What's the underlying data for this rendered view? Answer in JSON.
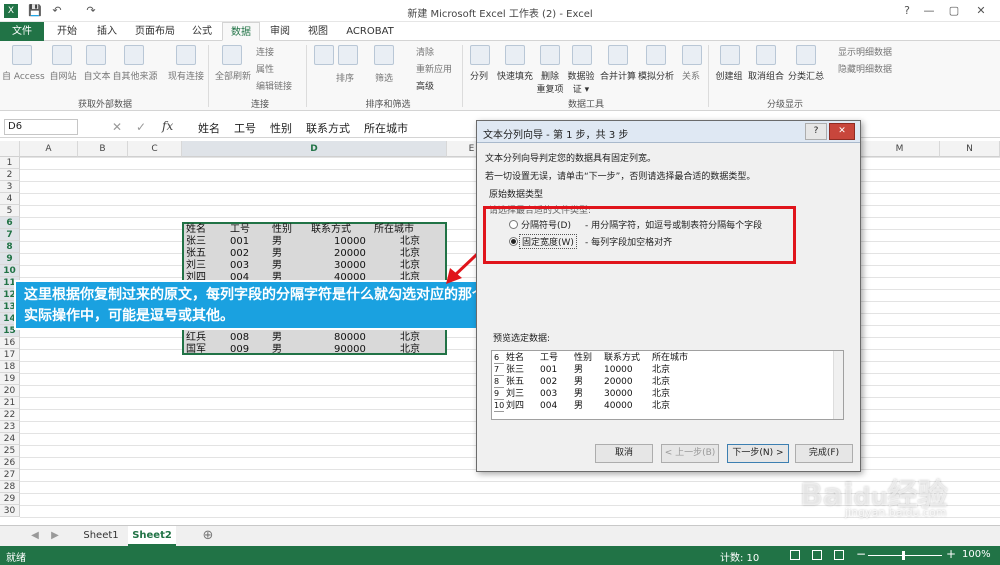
{
  "window": {
    "title": "新建 Microsoft Excel 工作表 (2) - Excel",
    "help": "?",
    "minimize": "—",
    "restore": "▢",
    "close": "✕"
  },
  "quick_access": {
    "save": "💾",
    "undo": "↶",
    "redo": "↷"
  },
  "tabs": [
    "文件",
    "开始",
    "插入",
    "页面布局",
    "公式",
    "数据",
    "审阅",
    "视图",
    "ACROBAT"
  ],
  "ribbon": {
    "get_external": {
      "items": [
        "自 Access",
        "自网站",
        "自文本",
        "自其他来源",
        "现有连接"
      ],
      "label": "获取外部数据"
    },
    "connections": {
      "refresh": "全部刷新",
      "items": [
        "连接",
        "属性",
        "编辑链接"
      ],
      "label": "连接"
    },
    "sort_filter": {
      "sort": "排序",
      "filter": "筛选",
      "items": [
        "清除",
        "重新应用",
        "高级"
      ],
      "label": "排序和筛选"
    },
    "data_tools": {
      "items": [
        "分列",
        "快速填充",
        "删除\n重复项",
        "数据验\n证 ▾",
        "合并计算",
        "模拟分析",
        "关系"
      ],
      "label": "数据工具"
    },
    "outline": {
      "items": [
        "创建组",
        "取消组合",
        "分类汇总"
      ],
      "right": [
        "显示明细数据",
        "隐藏明细数据"
      ],
      "label": "分级显示"
    }
  },
  "formula_bar": {
    "name_box": "D6",
    "fx": "fx",
    "content": "姓名    工号    性别    联系方式    所在城市"
  },
  "columns": [
    "A",
    "B",
    "C",
    "D",
    "E",
    "M",
    "N"
  ],
  "rows": [
    "1",
    "2",
    "3",
    "4",
    "5",
    "6",
    "7",
    "8",
    "9",
    "10",
    "11",
    "12",
    "13",
    "14",
    "15",
    "16",
    "17",
    "18",
    "19",
    "20",
    "21",
    "22",
    "23",
    "24",
    "25",
    "26",
    "27",
    "28",
    "29",
    "30"
  ],
  "table": {
    "header": [
      "姓名",
      "工号",
      "性别",
      "联系方式",
      "所在城市"
    ],
    "rows": [
      [
        "张三",
        "001",
        "男",
        "10000",
        "北京"
      ],
      [
        "张五",
        "002",
        "男",
        "20000",
        "北京"
      ],
      [
        "刘三",
        "003",
        "男",
        "30000",
        "北京"
      ],
      [
        "刘四",
        "004",
        "男",
        "40000",
        "北京"
      ],
      [
        "",
        "",
        "",
        "",
        ""
      ],
      [
        "",
        "",
        "",
        "",
        ""
      ],
      [
        "",
        "",
        "",
        "",
        ""
      ],
      [
        "",
        "",
        "",
        "",
        ""
      ],
      [
        "红兵",
        "008",
        "男",
        "80000",
        "北京"
      ],
      [
        "国军",
        "009",
        "男",
        "90000",
        "北京"
      ]
    ]
  },
  "callout": {
    "line1": "这里根据你复制过来的原文，每列字段的分隔字符是什么就勾选对应的那个。",
    "line2": "实际操作中，可能是逗号或其他。"
  },
  "dialog": {
    "title": "文本分列向导 - 第 1 步，共 3 步",
    "help": "?",
    "close": "✕",
    "line1": "文本分列向导判定您的数据具有固定列宽。",
    "line2": "若一切设置无误，请单击“下一步”，否则请选择最合适的数据类型。",
    "group": "原始数据类型",
    "group_sub": "请选择最合适的文件类型:",
    "opt1": "分隔符号(D)",
    "opt1_desc": "- 用分隔字符，如逗号或制表符分隔每个字段",
    "opt2": "固定宽度(W)",
    "opt2_desc": "- 每列字段加空格对齐",
    "preview_label": "预览选定数据:",
    "preview_rows": [
      [
        "6",
        "姓名",
        "工号",
        "性别",
        "联系方式",
        "所在城市"
      ],
      [
        "7",
        "张三",
        "001",
        "男",
        "10000",
        "北京"
      ],
      [
        "8",
        "张五",
        "002",
        "男",
        "20000",
        "北京"
      ],
      [
        "9",
        "刘三",
        "003",
        "男",
        "30000",
        "北京"
      ],
      [
        "10",
        "刘四",
        "004",
        "男",
        "40000",
        "北京"
      ]
    ],
    "buttons": {
      "cancel": "取消",
      "back": "< 上一步(B)",
      "next": "下一步(N) >",
      "finish": "完成(F)"
    }
  },
  "sheets": [
    "Sheet1",
    "Sheet2"
  ],
  "status": {
    "ready": "就绪",
    "count": "计数: 10",
    "zoom": "100%"
  },
  "watermark": "Baidu经验 jingyan.baidu.com",
  "colors": {
    "accent": "#217346",
    "callout": "#1aa1e0",
    "highlight": "#e0141b"
  }
}
